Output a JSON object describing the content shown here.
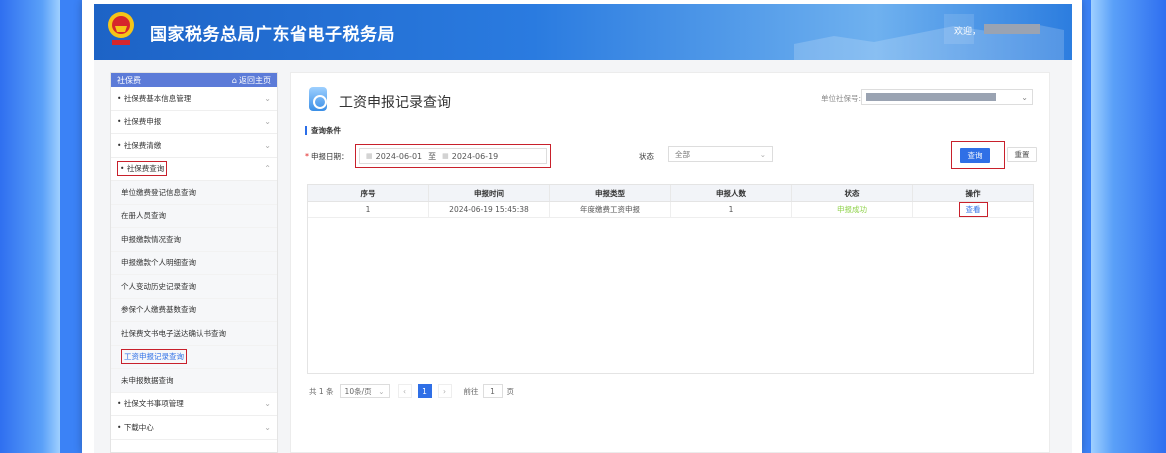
{
  "header": {
    "title": "国家税务总局广东省电子税务局",
    "welcome": "欢迎，"
  },
  "sidebar": {
    "head": "社保费",
    "home": "返回主页",
    "items": [
      {
        "label": "社保费基本信息管理"
      },
      {
        "label": "社保费申报"
      },
      {
        "label": "社保费清缴"
      },
      {
        "label": "社保费查询"
      }
    ],
    "subitems": [
      {
        "label": "单位缴费登记信息查询"
      },
      {
        "label": "在册人员查询"
      },
      {
        "label": "申报缴款情况查询"
      },
      {
        "label": "申报缴款个人明细查询"
      },
      {
        "label": "个人变动历史记录查询"
      },
      {
        "label": "参保个人缴费基数查询"
      },
      {
        "label": "社保费文书电子送达确认书查询"
      },
      {
        "label": "工资申报记录查询"
      },
      {
        "label": "未申报数据查询"
      }
    ],
    "items2": [
      {
        "label": "社保文书事项管理"
      },
      {
        "label": "下载中心"
      }
    ]
  },
  "content": {
    "title": "工资申报记录查询",
    "unit_label": "单位社保号:",
    "section": "查询条件",
    "date_label": "申报日期：",
    "date_from": "2024-06-01",
    "date_sep": "至",
    "date_to": "2024-06-19",
    "status_label": "状态",
    "status_value": "全部",
    "query_btn": "查询",
    "reset_btn": "重置"
  },
  "table": {
    "headers": [
      "序号",
      "申报时间",
      "申报类型",
      "申报人数",
      "状态",
      "操作"
    ],
    "rows": [
      {
        "no": "1",
        "time": "2024-06-19 15:45:38",
        "type": "年度缴费工资申报",
        "count": "1",
        "status": "申报成功",
        "action": "查看"
      }
    ]
  },
  "pager": {
    "total": "共 1 条",
    "size": "10条/页",
    "page": "1",
    "goto": "前往",
    "goto_page": "1",
    "unit": "页"
  },
  "colors": {
    "accent": "#2f6fe6",
    "highlight": "#c8202b",
    "success": "#8fd24a"
  },
  "icons": [
    "emblem-icon",
    "home-icon",
    "chevron-down-icon",
    "chevron-up-icon",
    "calendar-icon",
    "record-search-icon"
  ]
}
